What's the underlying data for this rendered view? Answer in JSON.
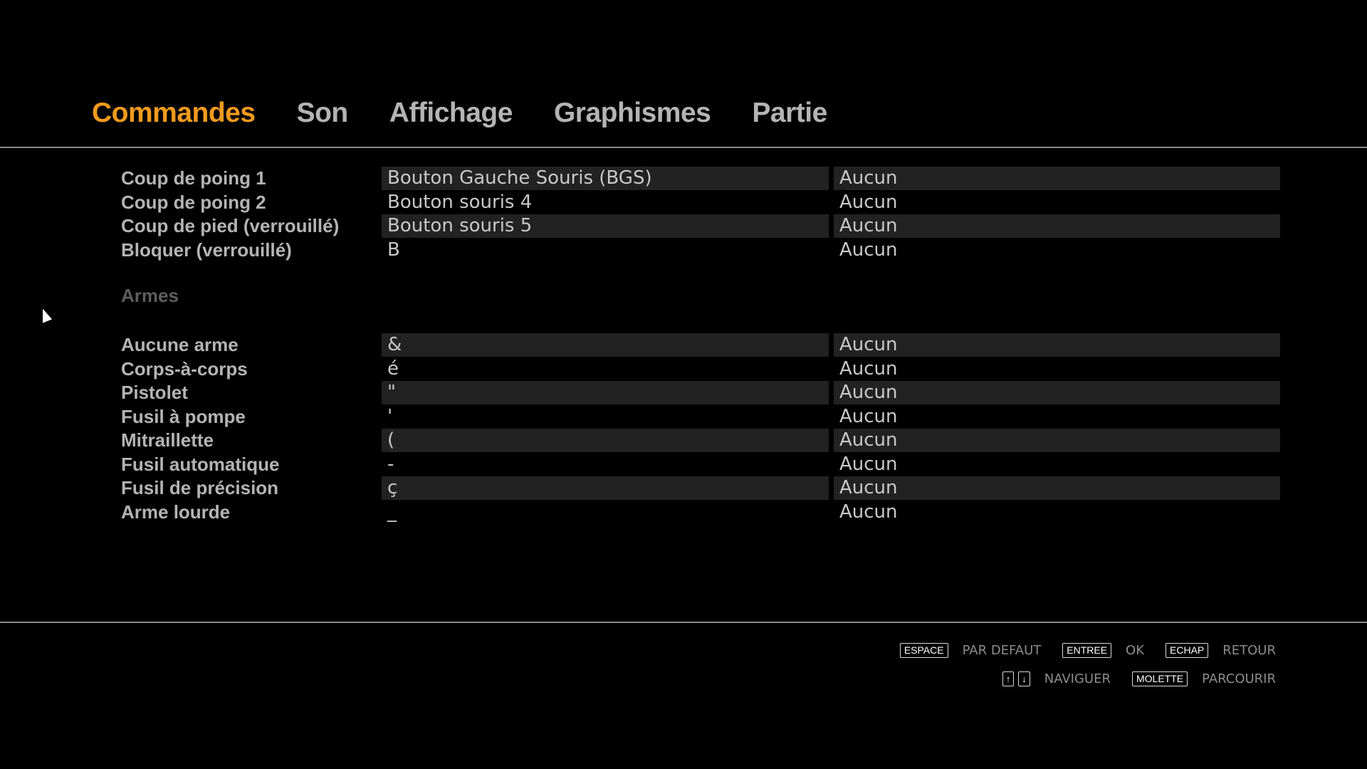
{
  "tabs": [
    {
      "label": "Commandes",
      "active": true
    },
    {
      "label": "Son",
      "active": false
    },
    {
      "label": "Affichage",
      "active": false
    },
    {
      "label": "Graphismes",
      "active": false
    },
    {
      "label": "Partie",
      "active": false
    }
  ],
  "combat": [
    {
      "action": "Coup de poing 1",
      "primary": "Bouton Gauche Souris (BGS)",
      "secondary": "Aucun"
    },
    {
      "action": "Coup de poing 2",
      "primary": "Bouton souris 4",
      "secondary": "Aucun"
    },
    {
      "action": "Coup de pied (verrouillé)",
      "primary": "Bouton souris 5",
      "secondary": "Aucun"
    },
    {
      "action": "Bloquer (verrouillé)",
      "primary": "B",
      "secondary": "Aucun"
    }
  ],
  "weapons_header": "Armes",
  "weapons": [
    {
      "action": "Aucune arme",
      "primary": "&",
      "secondary": "Aucun"
    },
    {
      "action": "Corps-à-corps",
      "primary": "é",
      "secondary": "Aucun"
    },
    {
      "action": "Pistolet",
      "primary": "\"",
      "secondary": "Aucun"
    },
    {
      "action": "Fusil à pompe",
      "primary": "'",
      "secondary": "Aucun"
    },
    {
      "action": "Mitraillette",
      "primary": "(",
      "secondary": "Aucun"
    },
    {
      "action": "Fusil automatique",
      "primary": "-",
      "secondary": "Aucun"
    },
    {
      "action": "Fusil de précision",
      "primary": "ç",
      "secondary": "Aucun"
    },
    {
      "action": "Arme lourde",
      "primary": "_",
      "secondary": "Aucun"
    }
  ],
  "hints": {
    "default_key": "ESPACE",
    "default_label": "PAR DEFAUT",
    "ok_key": "ENTREE",
    "ok_label": "OK",
    "back_key": "ECHAP",
    "back_label": "RETOUR",
    "up_arrow": "↑",
    "down_arrow": "↓",
    "navigate_label": "NAVIGUER",
    "scroll_key": "MOLETTE",
    "scroll_label": "PARCOURIR"
  },
  "icons": {
    "cursor": "mouse-pointer-icon"
  },
  "colors": {
    "accent": "#f09a1e",
    "tab_inactive": "#b4b4b4",
    "section_header": "#5e5e5e"
  }
}
